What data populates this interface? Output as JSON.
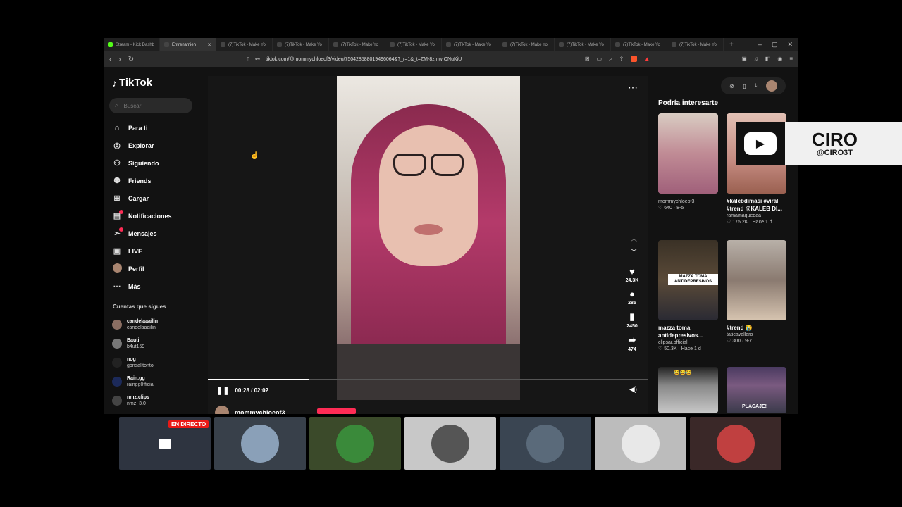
{
  "browser": {
    "tabs": [
      {
        "label": "Stream - Kick Dashb",
        "icon": "kick-icon"
      },
      {
        "label": "Entrenamien",
        "icon": "tiktok-icon",
        "active": true
      },
      {
        "label": "(7)TikTok - Make Yo",
        "icon": "tiktok-icon"
      },
      {
        "label": "(7)TikTok - Make Yo",
        "icon": "tiktok-icon"
      },
      {
        "label": "(7)TikTok - Make Yo",
        "icon": "tiktok-icon"
      },
      {
        "label": "(7)TikTok - Make Yo",
        "icon": "tiktok-icon"
      },
      {
        "label": "(7)TikTok - Make Yo",
        "icon": "tiktok-icon"
      },
      {
        "label": "(7)TikTok - Make Yo",
        "icon": "tiktok-icon"
      },
      {
        "label": "(7)TikTok - Make Yo",
        "icon": "tiktok-icon"
      },
      {
        "label": "(7)TikTok - Make Yo",
        "icon": "tiktok-icon"
      },
      {
        "label": "(7)TikTok - Make Yo",
        "icon": "tiktok-icon"
      }
    ],
    "url": "tiktok.com/@mommychloeof3/video/750428588019496064&?_r=1&_t=ZM-8zmwIONuKiU"
  },
  "sidebar": {
    "logo": "TikTok",
    "search_placeholder": "Buscar",
    "items": [
      {
        "label": "Para ti",
        "icon": "home-icon"
      },
      {
        "label": "Explorar",
        "icon": "compass-icon"
      },
      {
        "label": "Siguiendo",
        "icon": "following-icon"
      },
      {
        "label": "Friends",
        "icon": "friends-icon"
      },
      {
        "label": "Cargar",
        "icon": "upload-icon"
      },
      {
        "label": "Notificaciones",
        "icon": "bell-icon",
        "badge": true
      },
      {
        "label": "Mensajes",
        "icon": "message-icon",
        "badge": true
      },
      {
        "label": "LIVE",
        "icon": "live-icon"
      },
      {
        "label": "Perfil",
        "icon": "profile-avatar"
      },
      {
        "label": "Más",
        "icon": "more-icon"
      }
    ],
    "following_title": "Cuentas que sigues",
    "following": [
      {
        "name": "candelaaailin",
        "handle": "candelaaailin"
      },
      {
        "name": "Bauti",
        "handle": "b4ut159"
      },
      {
        "name": "nog",
        "handle": "gonsalitonto"
      },
      {
        "name": "Rain.gg",
        "handle": "raingg0fficial"
      },
      {
        "name": "nmz.clips",
        "handle": "nmz_3.0"
      }
    ]
  },
  "player": {
    "time": "00:28 / 02:02",
    "progress": 0.23,
    "likes": "24.3K",
    "comments": "285",
    "saves": "2450",
    "shares": "474",
    "author": "mommychloeof3"
  },
  "related": {
    "title": "Podría interesarte",
    "cards": [
      {
        "caption": "",
        "author": "mommychloeof3",
        "stats": "♡ 640 · 8-5"
      },
      {
        "caption": "#kalebdimasi #viral #trend @KALEB DI...",
        "author": "ramamaquedaa",
        "stats": "♡ 175.2K · Hace 1 d"
      },
      {
        "caption": "mazza toma antidepresivos...",
        "author": "clipsar.official",
        "stats": "♡ 50.3K · Hace 1 d",
        "overlay": "MAZZA TOMA ANTIDEPRESIVOS"
      },
      {
        "caption": "#trend 😭",
        "author": "taticavallaro",
        "stats": "♡ 300 · 9-7"
      },
      {
        "caption": "",
        "author": "",
        "stats": "",
        "overlay": "😂😂😂"
      },
      {
        "caption": "",
        "author": "",
        "stats": "",
        "overlay": "PLACAJE!"
      }
    ]
  },
  "overlay_brand": {
    "name": "CIRO",
    "handle": "@CIRO3T"
  },
  "webcams": {
    "live_label": "EN DIRECTO",
    "colors": [
      "#2e3440",
      "#38404a",
      "#3b4a2a",
      "#c8c8c8",
      "#3a4552",
      "#bcbcbc",
      "#3a2828"
    ]
  }
}
